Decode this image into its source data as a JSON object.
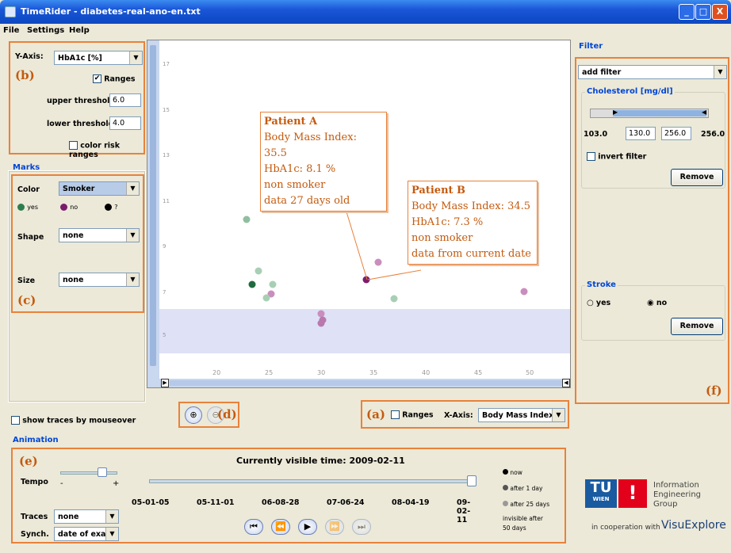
{
  "window": {
    "title": "TimeRider - diabetes-real-ano-en.txt",
    "min": "_",
    "max": "□",
    "close": "X"
  },
  "menu": [
    "File",
    "Settings",
    "Help"
  ],
  "panel_b": {
    "label": "(b)",
    "yaxis_label": "Y-Axis:",
    "yaxis_value": "HbA1c [%]",
    "ranges_label": "Ranges",
    "upper_label": "upper threshold",
    "upper_value": "6.0",
    "lower_label": "lower threshold",
    "lower_value": "4.0",
    "risk_label": "color risk ranges"
  },
  "marks": {
    "title": "Marks",
    "label": "(c)",
    "color_label": "Color",
    "color_value": "Smoker",
    "legend": [
      {
        "name": "yes",
        "color": "#2e7d4f"
      },
      {
        "name": "no",
        "color": "#7a1d6e"
      },
      {
        "name": "?",
        "color": "#000000"
      }
    ],
    "shape_label": "Shape",
    "shape_value": "none",
    "size_label": "Size",
    "size_value": "none"
  },
  "traces_mouseover": "show traces by mouseover",
  "zoom": {
    "label": "(d)"
  },
  "xaxis_panel": {
    "label": "(a)",
    "ranges": "Ranges",
    "xaxis_label": "X-Axis:",
    "xaxis_value": "Body Mass Index"
  },
  "chart": {
    "y_ticks": [
      "17",
      "15",
      "13",
      "11",
      "9",
      "7",
      "5"
    ],
    "x_ticks": [
      "20",
      "25",
      "30",
      "35",
      "40",
      "45",
      "50"
    ]
  },
  "calloutA": {
    "title": "Patient A",
    "l1": "Body Mass Index: 35.5",
    "l2": "HbA1c: 8.1 %",
    "l3": "non smoker",
    "l4": "data 27 days old"
  },
  "calloutB": {
    "title": "Patient B",
    "l1": "Body Mass Index: 34.5",
    "l2": "HbA1c: 7.3 %",
    "l3": "non smoker",
    "l4": "data from current date"
  },
  "filter": {
    "title": "Filter",
    "label": "(f)",
    "add": "add filter",
    "chol_title": "Cholesterol [mg/dl]",
    "chol_min": "103.0",
    "chol_lo": "130.0",
    "chol_hi": "256.0",
    "chol_max": "256.0",
    "invert": "invert filter",
    "remove": "Remove",
    "stroke_title": "Stroke",
    "yes": "yes",
    "no": "no",
    "remove2": "Remove"
  },
  "animation": {
    "title": "Animation",
    "label": "(e)",
    "visible_time": "Currently visible time: 2009-02-11",
    "tempo": "Tempo",
    "minus": "-",
    "plus": "+",
    "traces_label": "Traces",
    "traces_value": "none",
    "synch_label": "Synch.",
    "synch_value": "date of exa...",
    "dates": [
      "05-01-05",
      "05-11-01",
      "06-08-28",
      "07-06-24",
      "08-04-19",
      "09-02-11"
    ],
    "legend": [
      "now",
      "after 1 day",
      "after 25 days",
      "invisible after 50 days"
    ]
  },
  "logo": {
    "tu": "TU",
    "wien": "WIEN",
    "group1": "Information",
    "group2": "Engineering",
    "group3": "Group",
    "coop": "in cooperation with",
    "visu": "VisuExplore"
  }
}
